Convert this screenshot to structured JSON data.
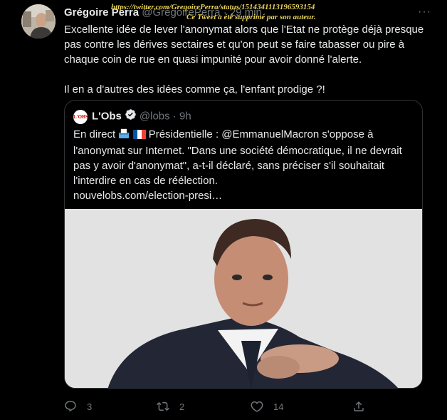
{
  "tweet": {
    "author_name": "Grégoire Perra",
    "author_handle": "@GregoirePerra",
    "time": "29 min",
    "paragraphs": [
      "Excellente idée de lever l'anonymat alors que l'Etat ne protège déjà presque pas contre les dérives sectaires et qu'on peut se faire tabasser ou pire à chaque coin de rue en quasi impunité pour avoir donné l'alerte.",
      "Il en a d'autres des idées comme ça, l'enfant prodige ?!"
    ],
    "more_icon": "ellipsis-icon"
  },
  "quote": {
    "logo_text": "L'OBS",
    "author_name": "L'Obs",
    "author_handle": "@lobs",
    "time": "9h",
    "text_prefix": "En direct",
    "text_flag_label": "Présidentielle : @EmmanuelMacron s'oppose à l'anonymat sur Internet. \"Dans une société démocratique, il ne devrait pas y avoir d'anonymat\", a-t-il déclaré, sans préciser s'il souhaitait l'interdire en cas de réélection.",
    "link": "nouvelobs.com/election-presi…"
  },
  "annotation": {
    "url": "https://twitter.com/GregoirePerra/status/1514341113196593154",
    "note": "Ce Tweet a été supprimé par son auteur."
  },
  "actions": {
    "reply_count": "3",
    "retweet_count": "2",
    "like_count": "14"
  },
  "colors": {
    "background": "#000000",
    "text": "#e7e9ea",
    "muted": "#71767b",
    "verified": "#e7e9ea",
    "annotation": "#e8d35a"
  }
}
